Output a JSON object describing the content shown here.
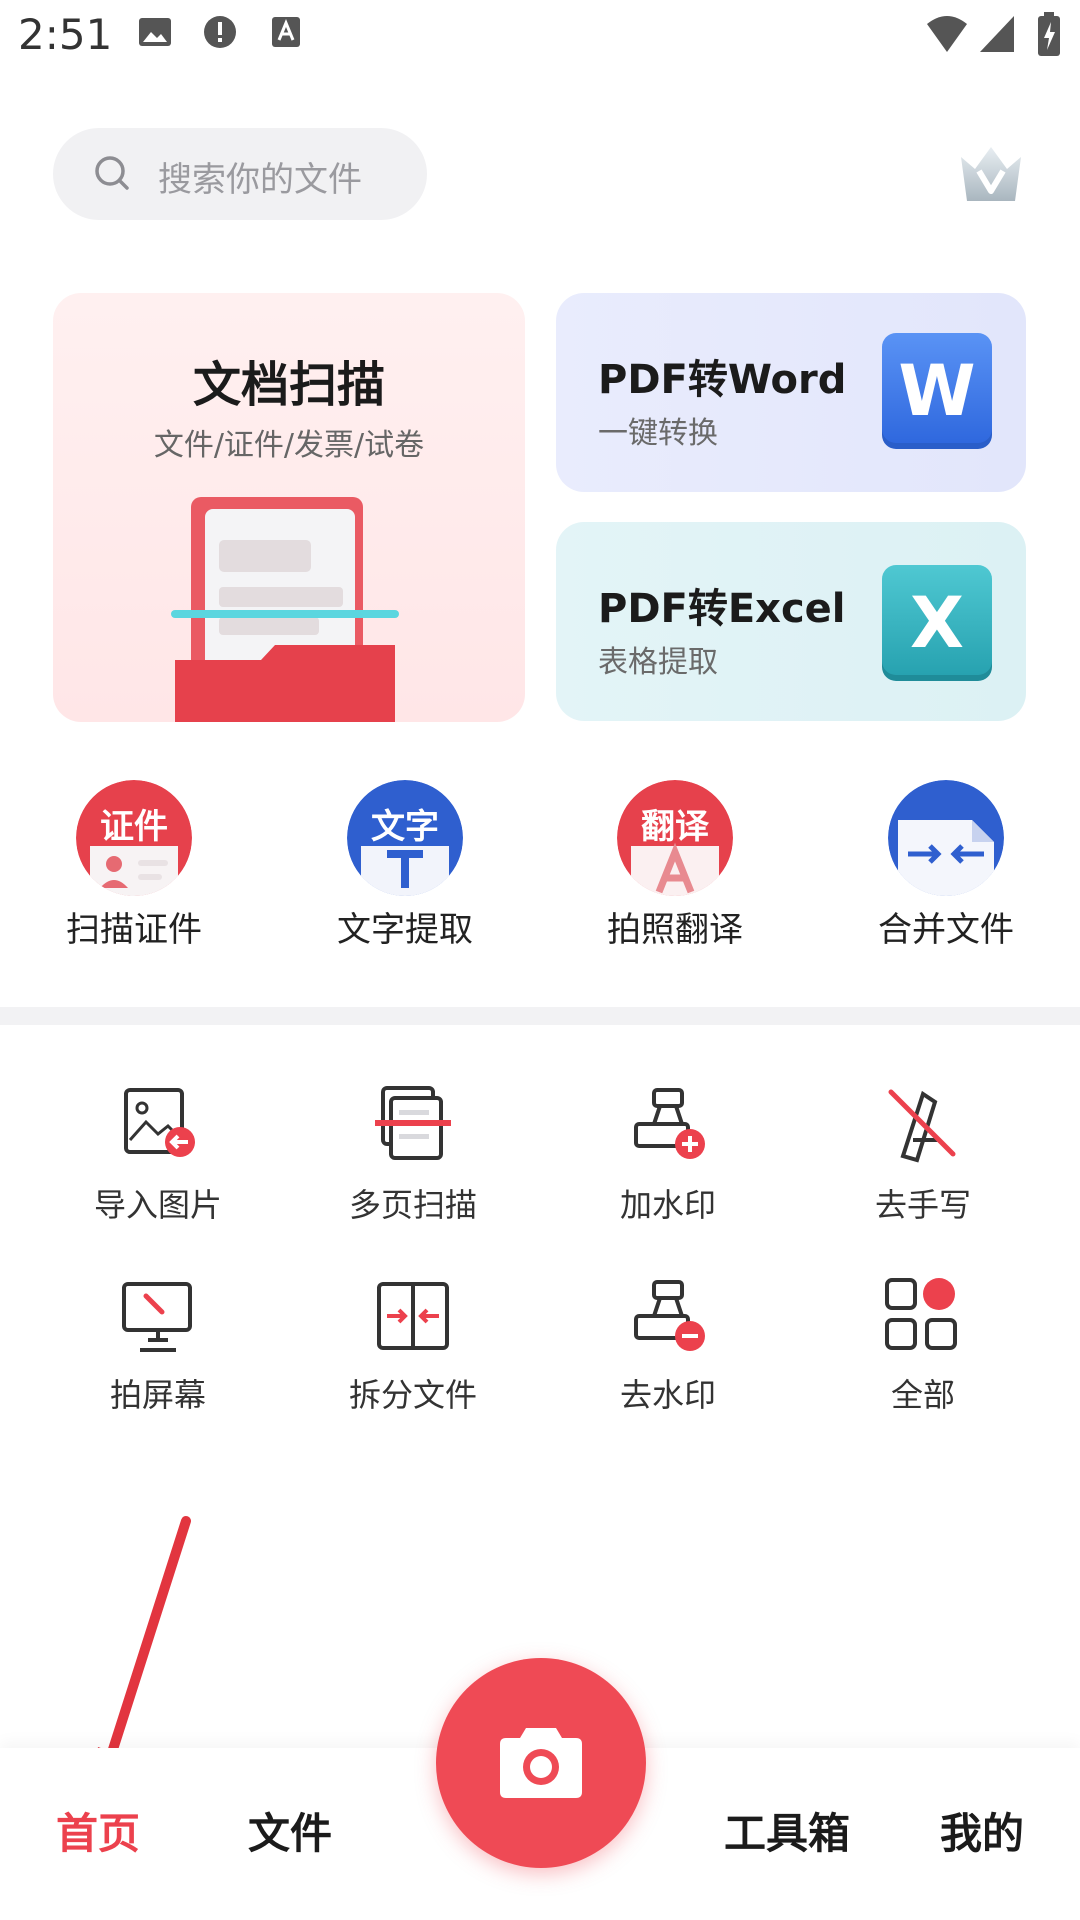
{
  "status_bar": {
    "time": "2:51"
  },
  "search": {
    "placeholder": "搜索你的文件"
  },
  "scan_card": {
    "title": "文档扫描",
    "subtitle": "文件/证件/发票/试卷"
  },
  "word_card": {
    "title": "PDF转Word",
    "subtitle": "一键转换",
    "badge": "W"
  },
  "excel_card": {
    "title": "PDF转Excel",
    "subtitle": "表格提取",
    "badge": "X"
  },
  "round_tools": [
    {
      "label": "扫描证件",
      "icon_text": "证件"
    },
    {
      "label": "文字提取",
      "icon_text": "文字"
    },
    {
      "label": "拍照翻译",
      "icon_text": "翻译"
    },
    {
      "label": "合并文件"
    }
  ],
  "grid_tools": [
    {
      "label": "导入图片"
    },
    {
      "label": "多页扫描"
    },
    {
      "label": "加水印"
    },
    {
      "label": "去手写"
    },
    {
      "label": "拍屏幕"
    },
    {
      "label": "拆分文件"
    },
    {
      "label": "去水印"
    },
    {
      "label": "全部"
    }
  ],
  "nav": {
    "home": "首页",
    "files": "文件",
    "toolbox": "工具箱",
    "mine": "我的"
  },
  "colors": {
    "accent": "#ec414d",
    "word_blue": "#3f7cf0",
    "excel_teal": "#33b6c2"
  }
}
